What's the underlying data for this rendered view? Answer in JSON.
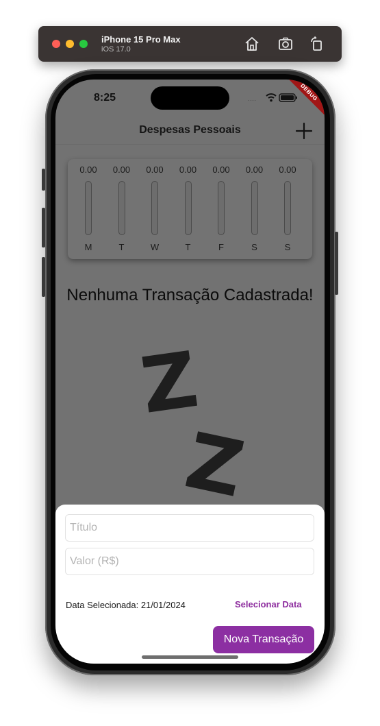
{
  "simulator": {
    "device_name": "iPhone 15 Pro Max",
    "os_version": "iOS 17.0",
    "toolbar_icons": [
      "home-icon",
      "screenshot-icon",
      "rotate-icon"
    ]
  },
  "status_bar": {
    "time": "8:25",
    "signal": "....",
    "icons": [
      "wifi-icon",
      "battery-icon"
    ],
    "debug_banner": "DEBUG"
  },
  "app_bar": {
    "title": "Despesas Pessoais",
    "action_icon": "add-icon"
  },
  "chart": {
    "days": [
      {
        "label": "M",
        "value": "0.00",
        "fill_fraction": 0
      },
      {
        "label": "T",
        "value": "0.00",
        "fill_fraction": 0
      },
      {
        "label": "W",
        "value": "0.00",
        "fill_fraction": 0
      },
      {
        "label": "T",
        "value": "0.00",
        "fill_fraction": 0
      },
      {
        "label": "F",
        "value": "0.00",
        "fill_fraction": 0
      },
      {
        "label": "S",
        "value": "0.00",
        "fill_fraction": 0
      },
      {
        "label": "S",
        "value": "0.00",
        "fill_fraction": 0
      }
    ]
  },
  "empty_state": {
    "message": "Nenhuma Transação Cadastrada!",
    "illustration": [
      "Z",
      "Z"
    ]
  },
  "form": {
    "title_placeholder": "Título",
    "title_value": "",
    "value_placeholder": "Valor (R$)",
    "value_value": "",
    "date_label": "Data Selecionada: 21/01/2024",
    "select_date_label": "Selecionar Data",
    "submit_label": "Nova Transação"
  },
  "colors": {
    "accent": "#8c2fa2",
    "scrim_background": "#727272",
    "sheet_background": "#ffffff"
  }
}
